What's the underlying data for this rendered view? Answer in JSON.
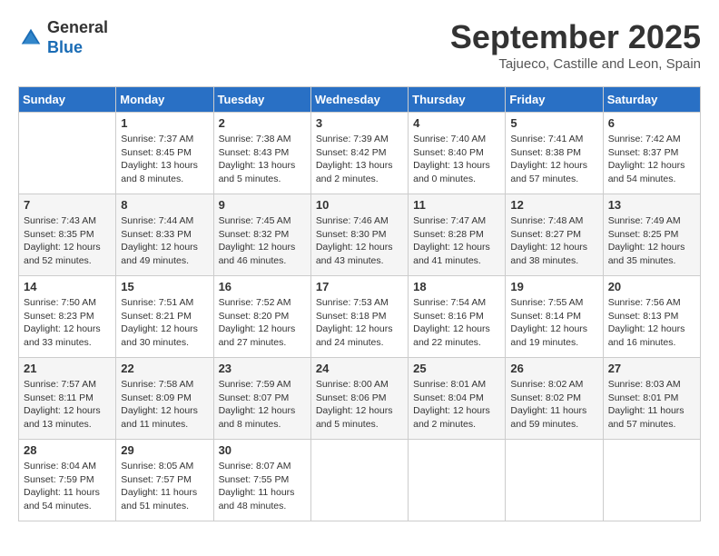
{
  "header": {
    "logo_line1": "General",
    "logo_line2": "Blue",
    "month": "September 2025",
    "location": "Tajueco, Castille and Leon, Spain"
  },
  "weekdays": [
    "Sunday",
    "Monday",
    "Tuesday",
    "Wednesday",
    "Thursday",
    "Friday",
    "Saturday"
  ],
  "weeks": [
    [
      {
        "day": "",
        "info": ""
      },
      {
        "day": "1",
        "info": "Sunrise: 7:37 AM\nSunset: 8:45 PM\nDaylight: 13 hours\nand 8 minutes."
      },
      {
        "day": "2",
        "info": "Sunrise: 7:38 AM\nSunset: 8:43 PM\nDaylight: 13 hours\nand 5 minutes."
      },
      {
        "day": "3",
        "info": "Sunrise: 7:39 AM\nSunset: 8:42 PM\nDaylight: 13 hours\nand 2 minutes."
      },
      {
        "day": "4",
        "info": "Sunrise: 7:40 AM\nSunset: 8:40 PM\nDaylight: 13 hours\nand 0 minutes."
      },
      {
        "day": "5",
        "info": "Sunrise: 7:41 AM\nSunset: 8:38 PM\nDaylight: 12 hours\nand 57 minutes."
      },
      {
        "day": "6",
        "info": "Sunrise: 7:42 AM\nSunset: 8:37 PM\nDaylight: 12 hours\nand 54 minutes."
      }
    ],
    [
      {
        "day": "7",
        "info": "Sunrise: 7:43 AM\nSunset: 8:35 PM\nDaylight: 12 hours\nand 52 minutes."
      },
      {
        "day": "8",
        "info": "Sunrise: 7:44 AM\nSunset: 8:33 PM\nDaylight: 12 hours\nand 49 minutes."
      },
      {
        "day": "9",
        "info": "Sunrise: 7:45 AM\nSunset: 8:32 PM\nDaylight: 12 hours\nand 46 minutes."
      },
      {
        "day": "10",
        "info": "Sunrise: 7:46 AM\nSunset: 8:30 PM\nDaylight: 12 hours\nand 43 minutes."
      },
      {
        "day": "11",
        "info": "Sunrise: 7:47 AM\nSunset: 8:28 PM\nDaylight: 12 hours\nand 41 minutes."
      },
      {
        "day": "12",
        "info": "Sunrise: 7:48 AM\nSunset: 8:27 PM\nDaylight: 12 hours\nand 38 minutes."
      },
      {
        "day": "13",
        "info": "Sunrise: 7:49 AM\nSunset: 8:25 PM\nDaylight: 12 hours\nand 35 minutes."
      }
    ],
    [
      {
        "day": "14",
        "info": "Sunrise: 7:50 AM\nSunset: 8:23 PM\nDaylight: 12 hours\nand 33 minutes."
      },
      {
        "day": "15",
        "info": "Sunrise: 7:51 AM\nSunset: 8:21 PM\nDaylight: 12 hours\nand 30 minutes."
      },
      {
        "day": "16",
        "info": "Sunrise: 7:52 AM\nSunset: 8:20 PM\nDaylight: 12 hours\nand 27 minutes."
      },
      {
        "day": "17",
        "info": "Sunrise: 7:53 AM\nSunset: 8:18 PM\nDaylight: 12 hours\nand 24 minutes."
      },
      {
        "day": "18",
        "info": "Sunrise: 7:54 AM\nSunset: 8:16 PM\nDaylight: 12 hours\nand 22 minutes."
      },
      {
        "day": "19",
        "info": "Sunrise: 7:55 AM\nSunset: 8:14 PM\nDaylight: 12 hours\nand 19 minutes."
      },
      {
        "day": "20",
        "info": "Sunrise: 7:56 AM\nSunset: 8:13 PM\nDaylight: 12 hours\nand 16 minutes."
      }
    ],
    [
      {
        "day": "21",
        "info": "Sunrise: 7:57 AM\nSunset: 8:11 PM\nDaylight: 12 hours\nand 13 minutes."
      },
      {
        "day": "22",
        "info": "Sunrise: 7:58 AM\nSunset: 8:09 PM\nDaylight: 12 hours\nand 11 minutes."
      },
      {
        "day": "23",
        "info": "Sunrise: 7:59 AM\nSunset: 8:07 PM\nDaylight: 12 hours\nand 8 minutes."
      },
      {
        "day": "24",
        "info": "Sunrise: 8:00 AM\nSunset: 8:06 PM\nDaylight: 12 hours\nand 5 minutes."
      },
      {
        "day": "25",
        "info": "Sunrise: 8:01 AM\nSunset: 8:04 PM\nDaylight: 12 hours\nand 2 minutes."
      },
      {
        "day": "26",
        "info": "Sunrise: 8:02 AM\nSunset: 8:02 PM\nDaylight: 11 hours\nand 59 minutes."
      },
      {
        "day": "27",
        "info": "Sunrise: 8:03 AM\nSunset: 8:01 PM\nDaylight: 11 hours\nand 57 minutes."
      }
    ],
    [
      {
        "day": "28",
        "info": "Sunrise: 8:04 AM\nSunset: 7:59 PM\nDaylight: 11 hours\nand 54 minutes."
      },
      {
        "day": "29",
        "info": "Sunrise: 8:05 AM\nSunset: 7:57 PM\nDaylight: 11 hours\nand 51 minutes."
      },
      {
        "day": "30",
        "info": "Sunrise: 8:07 AM\nSunset: 7:55 PM\nDaylight: 11 hours\nand 48 minutes."
      },
      {
        "day": "",
        "info": ""
      },
      {
        "day": "",
        "info": ""
      },
      {
        "day": "",
        "info": ""
      },
      {
        "day": "",
        "info": ""
      }
    ]
  ]
}
